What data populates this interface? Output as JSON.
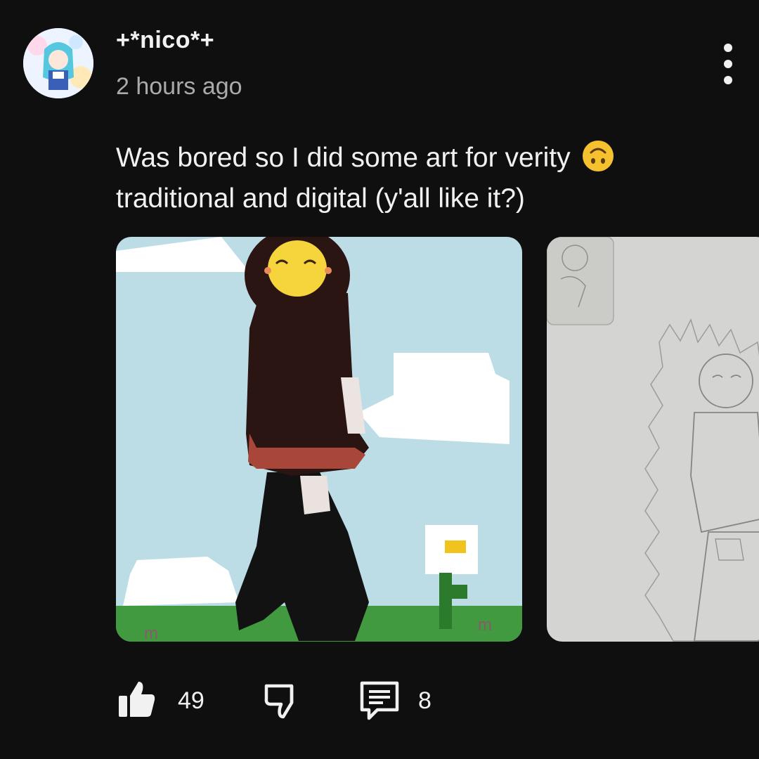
{
  "author": {
    "name": "+*nico*+",
    "time": "2 hours ago"
  },
  "post": {
    "text": "Was bored so I did some art for verity",
    "text_line2": "traditional and digital (y'all like it?)",
    "emoji": "upside-down-smiley"
  },
  "images": [
    {
      "kind": "digital-drawing"
    },
    {
      "kind": "pencil-sketch"
    }
  ],
  "actions": {
    "likes": "49",
    "comments": "8"
  },
  "colors": {
    "background": "#0f0f0f",
    "text": "#f1f1f1",
    "secondary": "#aaaaaa",
    "sky": "#bcdde6",
    "grass": "#3f9a3e"
  }
}
